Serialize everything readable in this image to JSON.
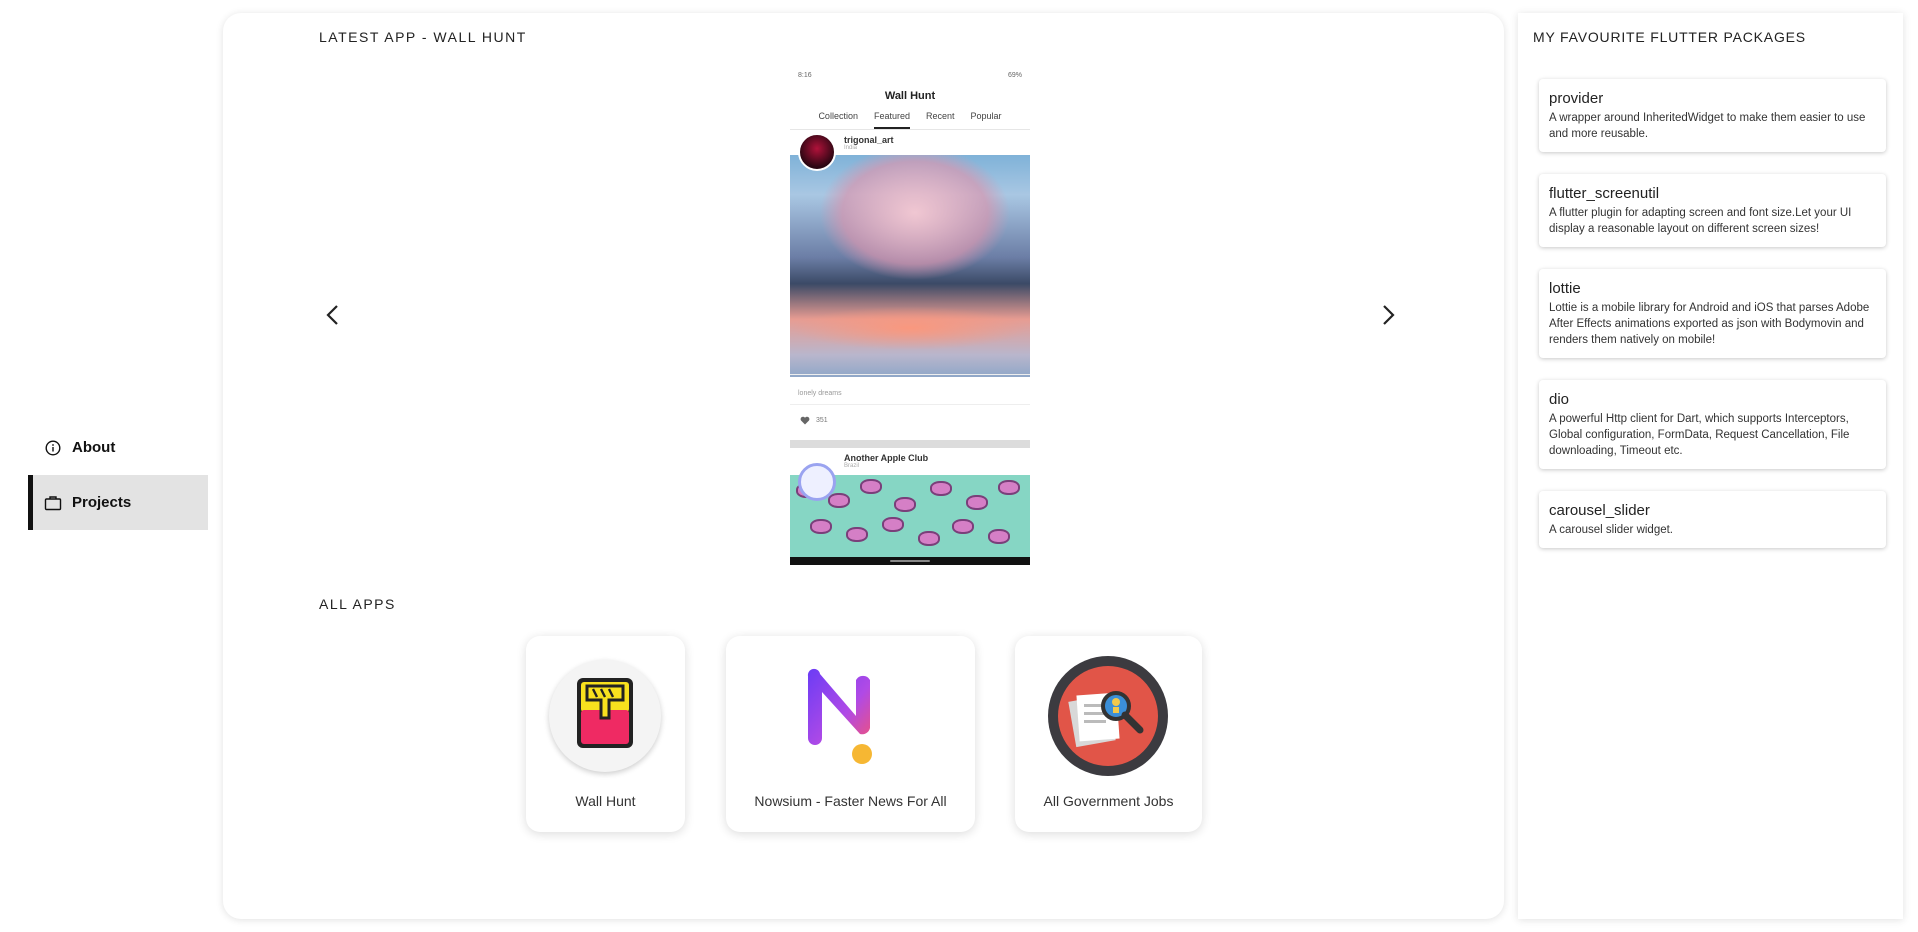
{
  "nav": {
    "items": [
      {
        "label": "About",
        "icon": "info-icon",
        "active": false
      },
      {
        "label": "Projects",
        "icon": "briefcase-icon",
        "active": true
      }
    ]
  },
  "main": {
    "latest_title": "LATEST APP - WALL HUNT",
    "carousel": {
      "prev_icon": "chevron-left-icon",
      "next_icon": "chevron-right-icon",
      "screenshot": {
        "status_time": "8:16",
        "status_battery": "69%",
        "app_title": "Wall Hunt",
        "tabs": [
          "Collection",
          "Featured",
          "Recent",
          "Popular"
        ],
        "active_tab": "Featured",
        "post1": {
          "user": "trigonal_art",
          "country": "India",
          "caption": "lonely dreams",
          "likes": "351"
        },
        "post2": {
          "user": "Another Apple Club",
          "country": "Brazil"
        }
      }
    },
    "all_apps_title": "ALL APPS",
    "apps": [
      {
        "name": "Wall Hunt",
        "icon": "wall-hunt-logo-icon"
      },
      {
        "name": "Nowsium - Faster News For All",
        "icon": "nowsium-logo-icon"
      },
      {
        "name": "All Government Jobs",
        "icon": "gov-jobs-logo-icon"
      }
    ]
  },
  "packages": {
    "title": "MY FAVOURITE FLUTTER PACKAGES",
    "items": [
      {
        "name": "provider",
        "desc": "A wrapper around InheritedWidget to make them easier to use and more reusable."
      },
      {
        "name": "flutter_screenutil",
        "desc": "A flutter plugin for adapting screen and font size.Let your UI display a reasonable layout on different screen sizes!"
      },
      {
        "name": "lottie",
        "desc": "Lottie is a mobile library for Android and iOS that parses Adobe After Effects animations exported as json with Bodymovin and renders them natively on mobile!"
      },
      {
        "name": "dio",
        "desc": "A powerful Http client for Dart, which supports Interceptors, Global configuration, FormData, Request Cancellation, File downloading, Timeout etc."
      },
      {
        "name": "carousel_slider",
        "desc": "A carousel slider widget."
      }
    ]
  },
  "colors": {
    "accent_bar": "#111111",
    "nav_active_bg": "#e3e3e3",
    "page_bg": "#ffffff"
  }
}
